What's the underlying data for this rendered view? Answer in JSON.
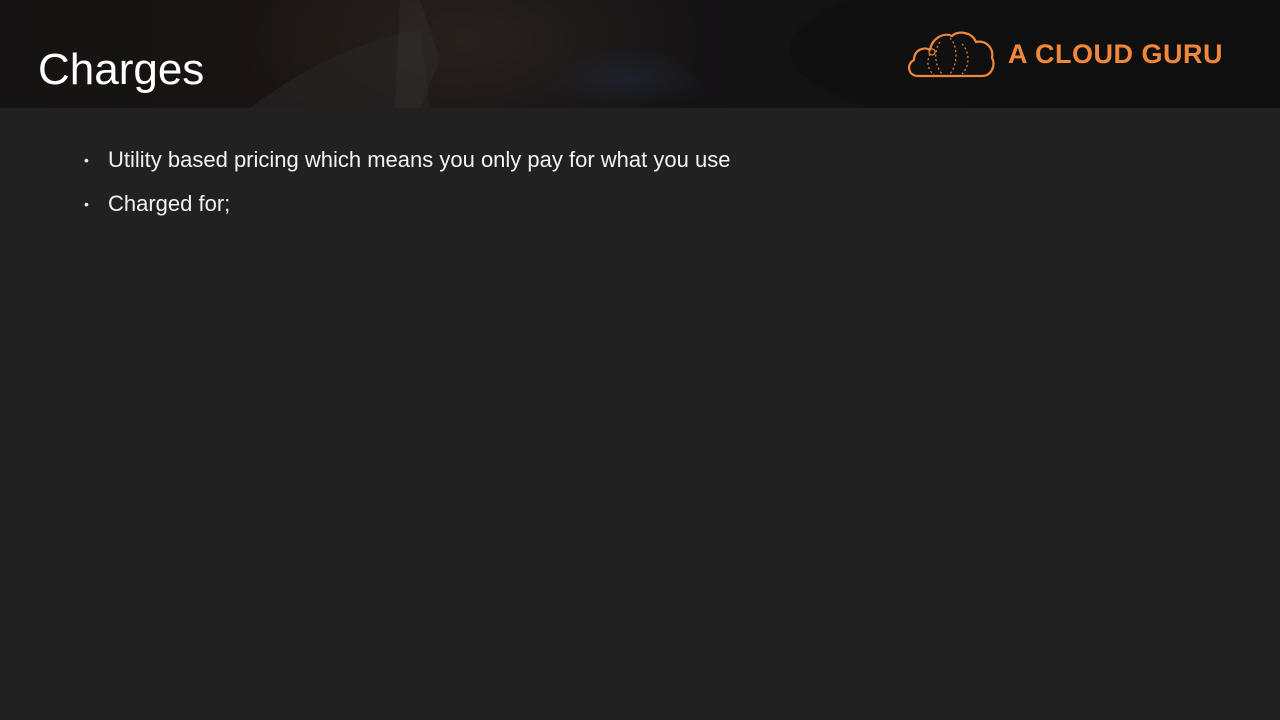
{
  "slide": {
    "title": "Charges",
    "brand": {
      "name": "A CLOUD GURU",
      "logo_icon": "cloud-logo-icon",
      "color": "#f0873b"
    },
    "bullets": [
      {
        "text": "Utility based pricing which means you only pay for what you use",
        "marker": "•"
      },
      {
        "text": "Charged for;",
        "marker": "•"
      }
    ]
  },
  "colors": {
    "background": "#212121",
    "header_background": "#1a1616",
    "title_text": "#ffffff",
    "body_text": "#f2f2f2",
    "accent": "#f0873b"
  }
}
